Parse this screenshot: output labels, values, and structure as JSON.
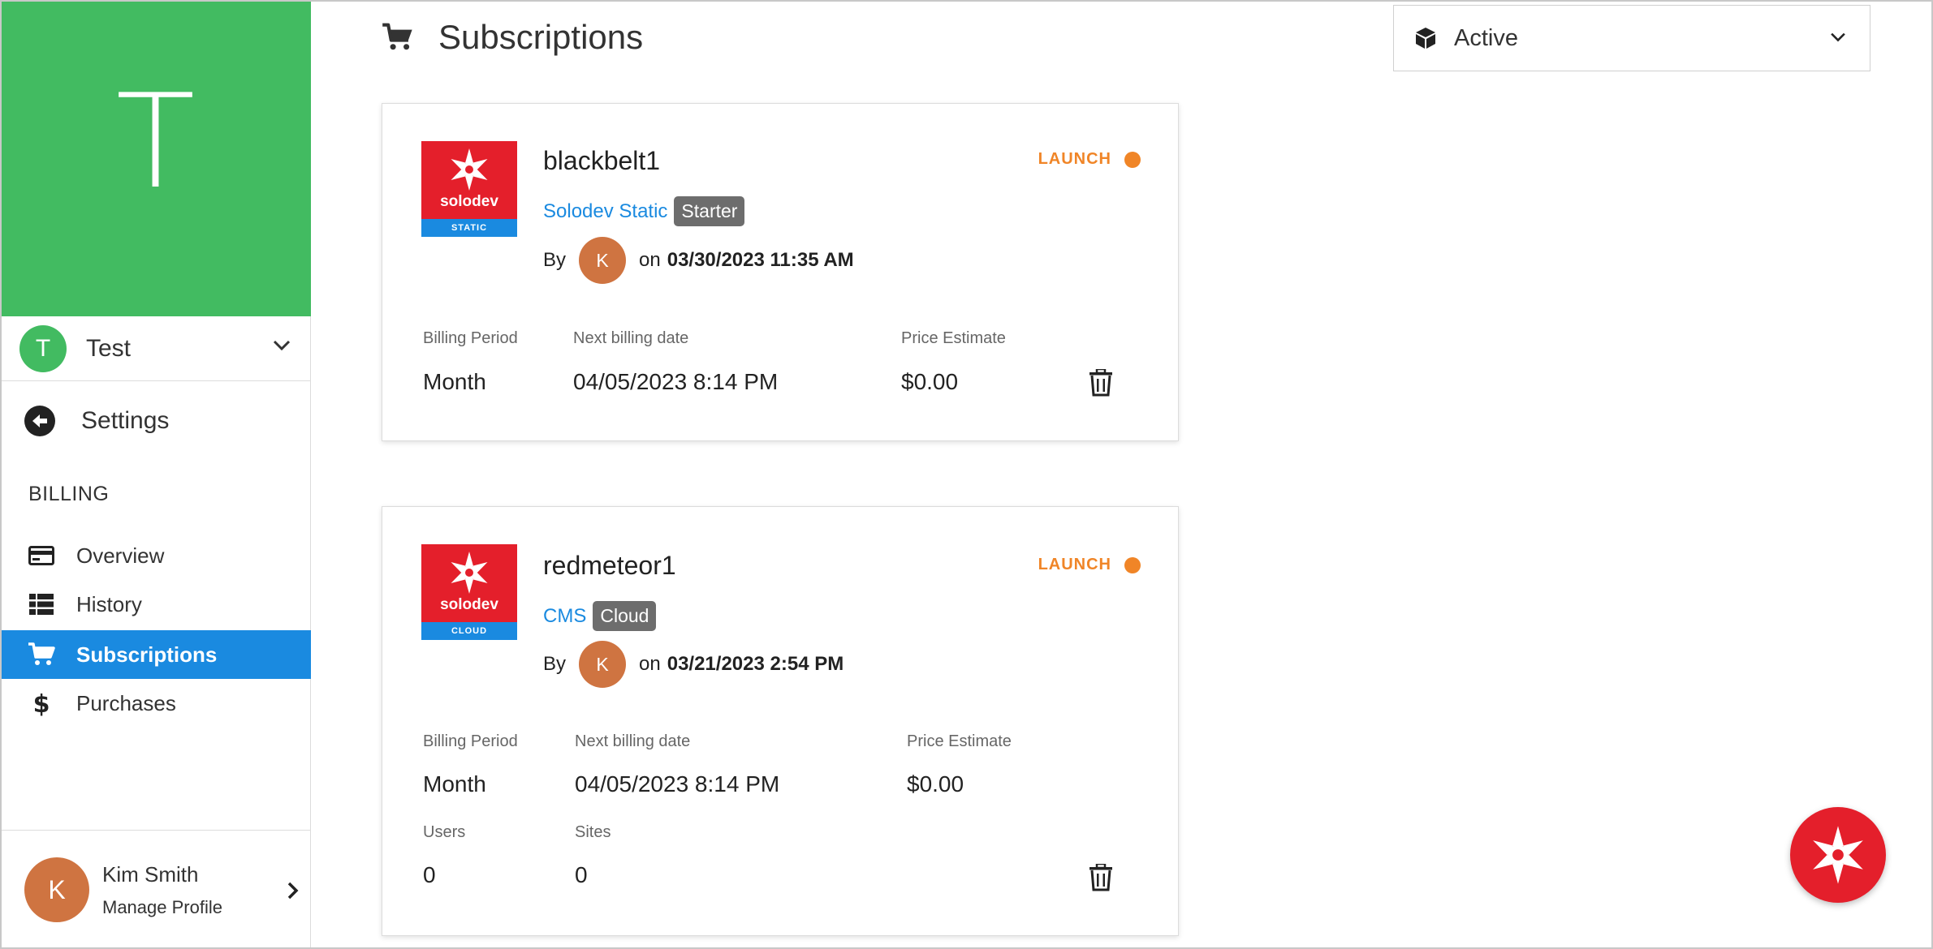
{
  "sidebar": {
    "hero_letter": "T",
    "org": {
      "avatar_letter": "T",
      "name": "Test"
    },
    "back": {
      "label": "Settings"
    },
    "section": "BILLING",
    "items": [
      {
        "label": "Overview",
        "icon": "credit-card-icon",
        "active": false
      },
      {
        "label": "History",
        "icon": "list-icon",
        "active": false
      },
      {
        "label": "Subscriptions",
        "icon": "cart-icon",
        "active": true
      },
      {
        "label": "Purchases",
        "icon": "dollar-icon",
        "active": false
      }
    ],
    "profile": {
      "avatar_letter": "K",
      "name": "Kim Smith",
      "link": "Manage Profile"
    }
  },
  "header": {
    "title": "Subscriptions",
    "filter": {
      "value": "Active",
      "icon": "cube-icon"
    }
  },
  "subscriptions": [
    {
      "name": "blackbelt1",
      "logo_text": "solodev",
      "logo_band": "STATIC",
      "product": "Solodev Static",
      "tier": "Starter",
      "by_label": "By",
      "avatar_letter": "K",
      "on_label": "on",
      "date": "03/30/2023 11:35 AM",
      "status": "LAUNCH",
      "fields": {
        "billing_period_label": "Billing Period",
        "billing_period": "Month",
        "next_billing_label": "Next billing date",
        "next_billing": "04/05/2023 8:14 PM",
        "price_label": "Price Estimate",
        "price": "$0.00"
      }
    },
    {
      "name": "redmeteor1",
      "logo_text": "solodev",
      "logo_band": "CLOUD",
      "product": "CMS",
      "tier": "Cloud",
      "by_label": "By",
      "avatar_letter": "K",
      "on_label": "on",
      "date": "03/21/2023 2:54 PM",
      "status": "LAUNCH",
      "fields": {
        "billing_period_label": "Billing Period",
        "billing_period": "Month",
        "next_billing_label": "Next billing date",
        "next_billing": "04/05/2023 8:14 PM",
        "price_label": "Price Estimate",
        "price": "$0.00",
        "users_label": "Users",
        "users": "0",
        "sites_label": "Sites",
        "sites": "0"
      }
    }
  ],
  "colors": {
    "hero": "#42bb61",
    "accent": "#1a8ae0",
    "launch": "#f08527",
    "brand_red": "#e41f2b",
    "avatar": "#cf7441"
  }
}
